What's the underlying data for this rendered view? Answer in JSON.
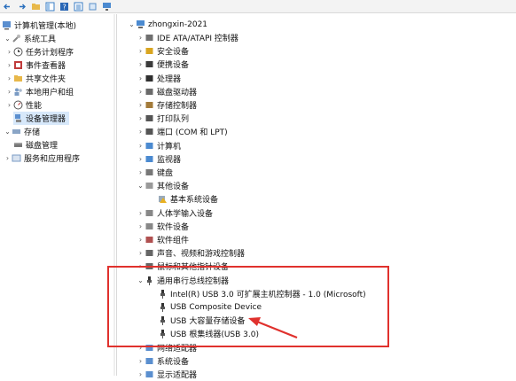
{
  "colors": {
    "accent_red": "#e0312d",
    "selection": "#d7e8fa",
    "divider": "#d9d9d9"
  },
  "toolbar": {
    "buttons": [
      "back-icon",
      "forward-icon",
      "folder-icon",
      "view-icon",
      "help-icon",
      "list-icon",
      "export-icon",
      "monitor-icon"
    ]
  },
  "left_tree": {
    "root": "计算机管理(本地)",
    "items": [
      {
        "label": "系统工具",
        "level": 1,
        "expanded": true
      },
      {
        "label": "任务计划程序",
        "level": 2
      },
      {
        "label": "事件查看器",
        "level": 2
      },
      {
        "label": "共享文件夹",
        "level": 2
      },
      {
        "label": "本地用户和组",
        "level": 2
      },
      {
        "label": "性能",
        "level": 2
      },
      {
        "label": "设备管理器",
        "level": 2,
        "selected": true
      },
      {
        "label": "存储",
        "level": 1,
        "expanded": true
      },
      {
        "label": "磁盘管理",
        "level": 2
      },
      {
        "label": "服务和应用程序",
        "level": 1
      }
    ]
  },
  "device_tree": {
    "computer": "zhongxin-2021",
    "categories": [
      {
        "label": "IDE ATA/ATAPI 控制器"
      },
      {
        "label": "安全设备"
      },
      {
        "label": "便携设备"
      },
      {
        "label": "处理器"
      },
      {
        "label": "磁盘驱动器"
      },
      {
        "label": "存储控制器"
      },
      {
        "label": "打印队列"
      },
      {
        "label": "端口 (COM 和 LPT)"
      },
      {
        "label": "计算机"
      },
      {
        "label": "监视器"
      },
      {
        "label": "键盘"
      },
      {
        "label": "其他设备",
        "expanded": true
      },
      {
        "label": "基本系统设备",
        "child": true
      },
      {
        "label": "人体学输入设备"
      },
      {
        "label": "软件设备"
      },
      {
        "label": "软件组件"
      },
      {
        "label": "声音、视频和游戏控制器"
      },
      {
        "label": "鼠标和其他指针设备"
      },
      {
        "label": "通用串行总线控制器",
        "expanded": true
      },
      {
        "label": "Intel(R) USB 3.0 可扩展主机控制器 - 1.0 (Microsoft)",
        "child": true
      },
      {
        "label": "USB Composite Device",
        "child": true
      },
      {
        "label": "USB 大容量存储设备",
        "child": true
      },
      {
        "label": "USB 根集线器(USB 3.0)",
        "child": true
      },
      {
        "label": "网络适配器"
      },
      {
        "label": "系统设备"
      },
      {
        "label": "显示适配器"
      }
    ]
  }
}
